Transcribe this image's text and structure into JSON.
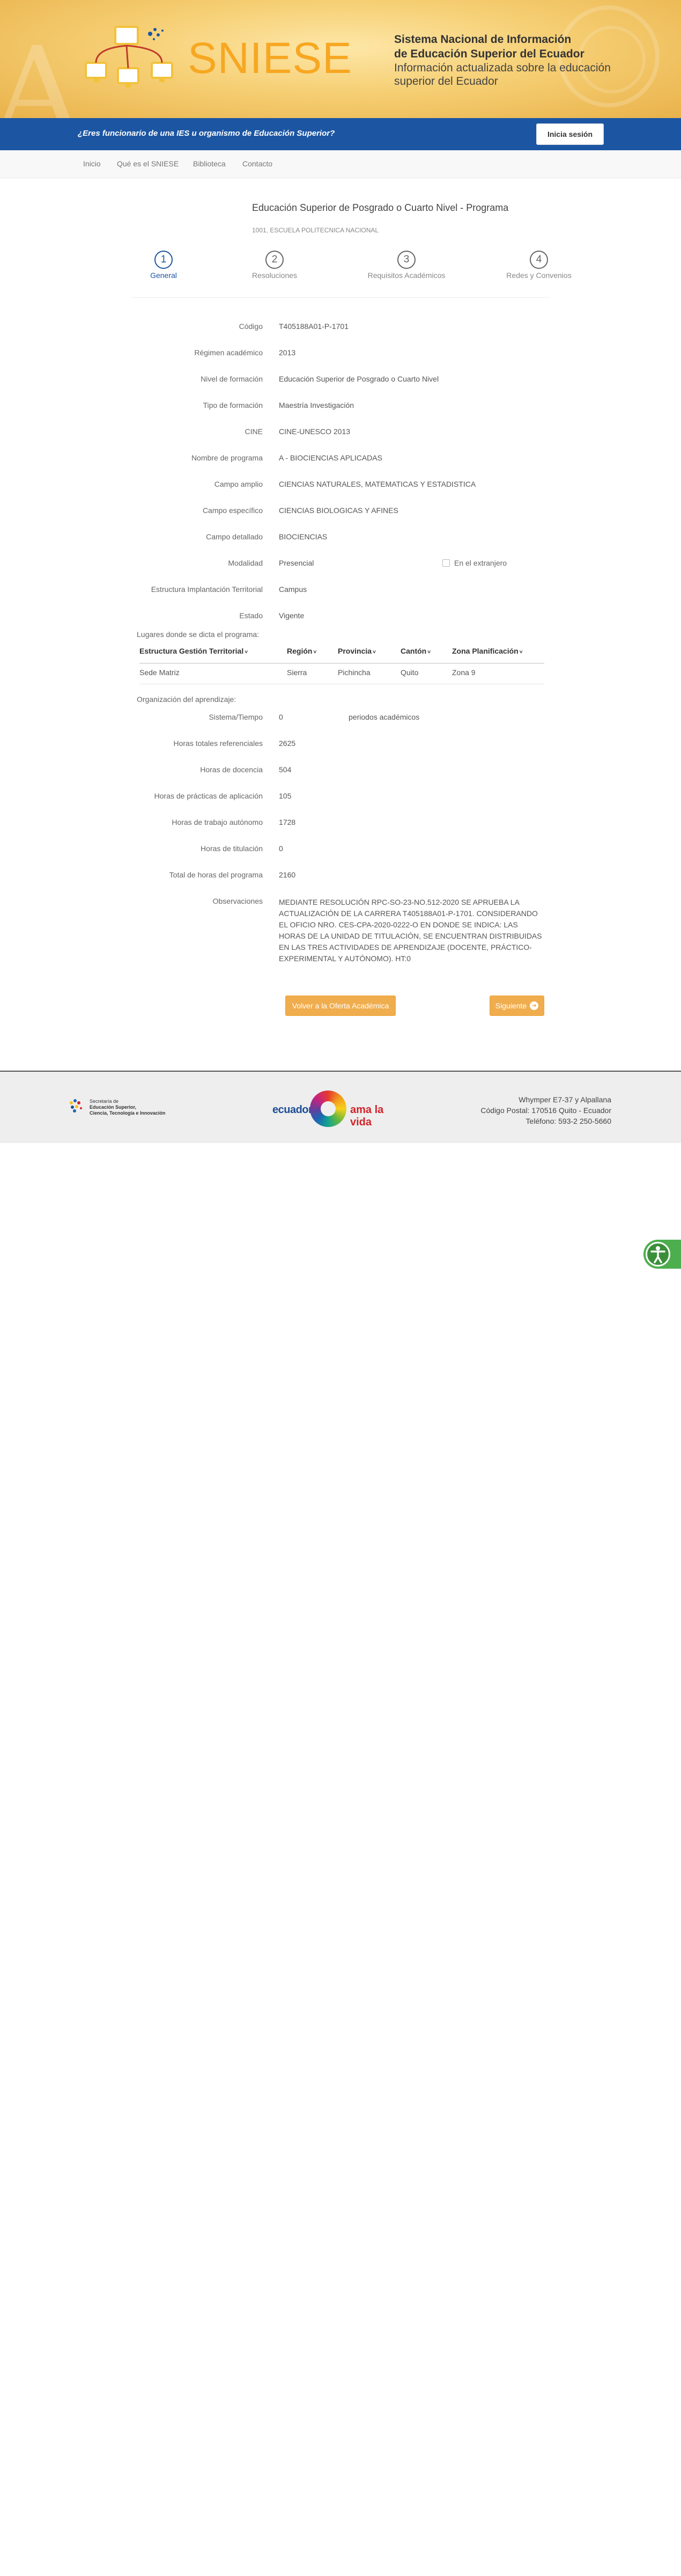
{
  "header": {
    "logo_text": "SNIESE",
    "title_line1": "Sistema Nacional de Información",
    "title_line2": "de Educación Superior del Ecuador",
    "subtitle_line1": "Información actualizada sobre la educación",
    "subtitle_line2": "superior del Ecuador"
  },
  "bluebar": {
    "question": "¿Eres funcionario de una IES u organismo de Educación Superior?",
    "login_label": "Inicia sesión"
  },
  "nav": {
    "items": [
      "Inicio",
      "Qué es el SNIESE",
      "Biblioteca",
      "Contacto"
    ]
  },
  "program": {
    "title": "Educación Superior de Posgrado o Cuarto Nivel - Programa",
    "institution": "1001, ESCUELA POLITECNICA NACIONAL"
  },
  "steps": [
    {
      "number": "1",
      "label": "General"
    },
    {
      "number": "2",
      "label": "Resoluciones"
    },
    {
      "number": "3",
      "label": "Requisitos Académicos"
    },
    {
      "number": "4",
      "label": "Redes y Convenios"
    }
  ],
  "details": [
    {
      "label": "Código",
      "value": "T405188A01-P-1701"
    },
    {
      "label": "Régimen académico",
      "value": "2013"
    },
    {
      "label": "Nivel de formación",
      "value": "Educación Superior de Posgrado o Cuarto Nivel"
    },
    {
      "label": "Tipo de formación",
      "value": "Maestría Investigación"
    },
    {
      "label": "CINE",
      "value": "CINE-UNESCO 2013"
    },
    {
      "label": "Nombre de programa",
      "value": "A - BIOCIENCIAS APLICADAS"
    },
    {
      "label": "Campo amplio",
      "value": "CIENCIAS NATURALES, MATEMATICAS Y ESTADISTICA"
    },
    {
      "label": "Campo específico",
      "value": "CIENCIAS BIOLOGICAS Y AFINES"
    },
    {
      "label": "Campo detallado",
      "value": "BIOCIENCIAS"
    },
    {
      "label": "Modalidad",
      "value": "Presencial"
    },
    {
      "label": "Estructura Implantación Territorial",
      "value": "Campus"
    },
    {
      "label": "Estado",
      "value": "Vigente"
    }
  ],
  "abroad_label": "En el extranjero",
  "locations": {
    "caption": "Lugares donde se dicta el programa:",
    "headers": [
      "Estructura Gestión Territorial",
      "Región",
      "Provincia",
      "Cantón",
      "Zona Planificación"
    ],
    "row": [
      "Sede Matriz",
      "Sierra",
      "Pichincha",
      "Quito",
      "Zona 9"
    ]
  },
  "learning": {
    "caption": "Organización del aprendizaje:",
    "system_label": "Sistema/Tiempo",
    "system_value": "0",
    "system_unit": "periodos académicos",
    "rows": [
      {
        "label": "Horas totales referenciales",
        "value": "2625"
      },
      {
        "label": "Horas de docencia",
        "value": "504"
      },
      {
        "label": "Horas de prácticas de aplicación",
        "value": "105"
      },
      {
        "label": "Horas de trabajo autónomo",
        "value": "1728"
      },
      {
        "label": "Horas de titulación",
        "value": "0"
      },
      {
        "label": "Total de horas del programa",
        "value": "2160"
      }
    ]
  },
  "observations": {
    "label": "Observaciones",
    "text": "MEDIANTE RESOLUCIÓN RPC-SO-23-No.512-2020 SE APRUEBA LA ACTUALIZACIÓN DE LA CARRERA T405188A01-P-1701. CONSIDERANDO EL OFICIO NRO. CES-CPA-2020-0222-O EN DONDE SE INDICA: LAS HORAS DE LA UNIDAD DE TITULACIÓN, SE ENCUENTRAN DISTRIBUIDAS EN LAS TRES ACTIVIDADES DE APRENDIZAJE (DOCENTE, PRÁCTICO-EXPERIMENTAL Y AUTÓNOMO). HT:0"
  },
  "buttons": {
    "back": "Volver a la Oferta Académica",
    "next": "Siguiente"
  },
  "footer": {
    "ses_line1": "Secretaría de",
    "ses_line2": "Educación Superior,",
    "ses_line3": "Ciencia, Tecnología e Innovación",
    "ecuador_word": "ecuador",
    "ama_word": "ama la vida",
    "address_line1": "Whymper E7-37 y Alpallana",
    "address_line2": "Código Postal: 170516 Quito - Ecuador",
    "address_line3": "Teléfono: 593-2 250-5660"
  },
  "colors": {
    "brand_blue": "#1c56a3",
    "brand_orange": "#f7a722",
    "button_orange": "#f0ad4e"
  },
  "icons": {
    "logo": "network-computers-icon",
    "next": "arrow-right-circle-icon",
    "accessibility": "accessibility-icon"
  }
}
